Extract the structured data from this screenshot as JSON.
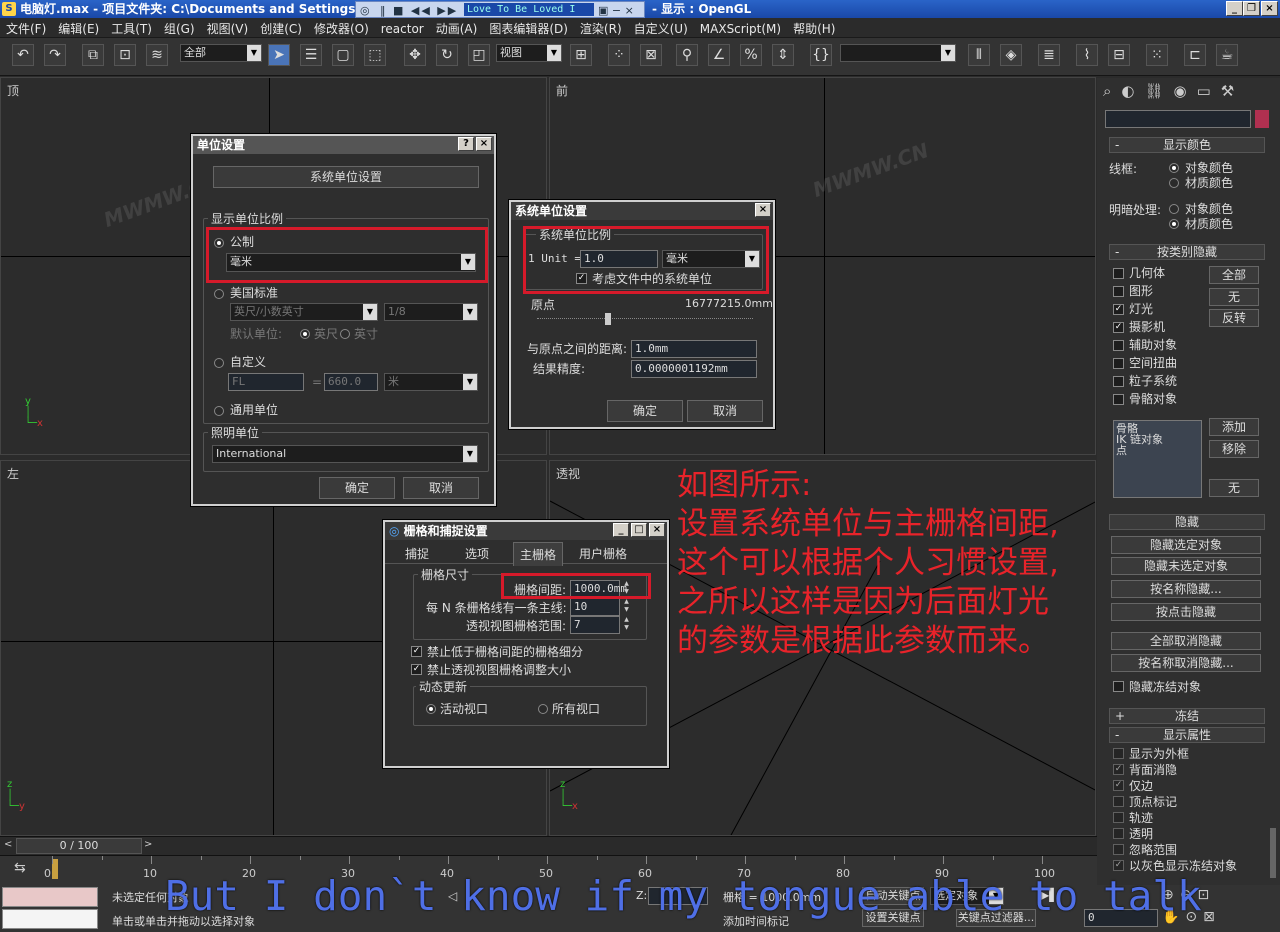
{
  "window": {
    "title": "电脑灯.max   - 项目文件夹: C:\\Documents and Settings\\",
    "suffix": "- 显示 : OpenGL",
    "app_icon": "3ds-max-icon"
  },
  "media": {
    "song": "Love To Be Loved I"
  },
  "menu": [
    "文件(F)",
    "编辑(E)",
    "工具(T)",
    "组(G)",
    "视图(V)",
    "创建(C)",
    "修改器(O)",
    "reactor",
    "动画(A)",
    "图表编辑器(D)",
    "渲染(R)",
    "自定义(U)",
    "MAXScript(M)",
    "帮助(H)"
  ],
  "toolbar": {
    "selection_filter": "全部",
    "ref_coord": "视图"
  },
  "viewports": {
    "top": "顶",
    "front": "前",
    "left": "左",
    "persp": "透视"
  },
  "watermark": "MWMW.CN",
  "units_dialog": {
    "title": "单位设置",
    "help": "?",
    "close": "×",
    "system_btn": "系统单位设置",
    "display_group": "显示单位比例",
    "metric_label": "公制",
    "metric_value": "毫米",
    "us_label": "美国标准",
    "us_value": "英尺/小数英寸",
    "us_frac": "1/8",
    "default_unit": "默认单位:",
    "feet": "英尺",
    "inch": "英寸",
    "custom_label": "自定义",
    "custom_name": "FL",
    "custom_eq": "=",
    "custom_value": "660.0",
    "custom_unit": "米",
    "generic_label": "通用单位",
    "lighting_group": "照明单位",
    "lighting_value": "International",
    "ok": "确定",
    "cancel": "取消"
  },
  "sys_dialog": {
    "title": "系统单位设置",
    "close": "×",
    "group": "系统单位比例",
    "unit_prefix": "1 Unit =",
    "unit_value": "1.0",
    "unit_type": "毫米",
    "respect_label": "考虑文件中的系统单位",
    "origin_label": "原点",
    "origin_value": "16777215.0mm",
    "distance_label": "与原点之间的距离:",
    "distance_value": "1.0mm",
    "precision_label": "结果精度:",
    "precision_value": "0.0000001192mm",
    "ok": "确定",
    "cancel": "取消"
  },
  "grid_dialog": {
    "title": "栅格和捕捉设置",
    "tabs": [
      "捕捉",
      "选项",
      "主栅格",
      "用户栅格"
    ],
    "size_group": "栅格尺寸",
    "spacing_label": "栅格间距:",
    "spacing_value": "1000.0mm",
    "major_label": "每 N 条栅格线有一条主线:",
    "major_value": "10",
    "persp_label": "透视视图栅格范围:",
    "persp_value": "7",
    "inhibit_sub": "禁止低于栅格间距的栅格细分",
    "inhibit_persp": "禁止透视视图栅格调整大小",
    "update_group": "动态更新",
    "active_vp": "活动视口",
    "all_vp": "所有视口"
  },
  "annotation": [
    "如图所示:",
    "设置系统单位与主栅格间距,",
    "这个可以根据个人习惯设置,",
    "之所以这样是因为后面灯光",
    "的参数是根据此参数而来。"
  ],
  "panel": {
    "display_color": "显示颜色",
    "wireframe": "线框:",
    "shaded": "明暗处理:",
    "object_color": "对象颜色",
    "material_color": "材质颜色",
    "hide_by_cat": "按类别隐藏",
    "cats": [
      "几何体",
      "图形",
      "灯光",
      "摄影机",
      "辅助对象",
      "空间扭曲",
      "粒子系统",
      "骨骼对象"
    ],
    "cat_checked": [
      false,
      false,
      true,
      true,
      false,
      false,
      false,
      false
    ],
    "all": "全部",
    "none": "无",
    "invert": "反转",
    "list": [
      "骨骼",
      "IK 链对象",
      "点"
    ],
    "add": "添加",
    "remove": "移除",
    "none2": "无",
    "hide": "隐藏",
    "hide_sel": "隐藏选定对象",
    "hide_unsel": "隐藏未选定对象",
    "hide_name": "按名称隐藏...",
    "hide_click": "按点击隐藏",
    "unhide_all": "全部取消隐藏",
    "unhide_name": "按名称取消隐藏...",
    "hide_frozen": "隐藏冻结对象",
    "freeze": "冻结",
    "disp_props": "显示属性",
    "props": [
      "显示为外框",
      "背面消隐",
      "仅边",
      "顶点标记",
      "轨迹",
      "透明",
      "忽略范围",
      "以灰色显示冻结对象"
    ],
    "props_checked": [
      false,
      true,
      true,
      false,
      false,
      false,
      false,
      true
    ]
  },
  "timeline": {
    "frame": "0 / 100",
    "ticks": [
      "0",
      "10",
      "20",
      "30",
      "40",
      "50",
      "60",
      "70",
      "80",
      "90",
      "100"
    ]
  },
  "status": {
    "selected": "未选定任何对象",
    "prompt": "单击或单击并拖动以选择对象",
    "grid": "栅格 = 1000.0mm",
    "autokey": "自动关键点",
    "setkey": "设置关键点",
    "addtime": "添加时间标记",
    "selected_set": "选定对象",
    "keyfilter": "关键点过滤器...",
    "frame_field": "0"
  },
  "subtitle": "But I don`t know if my tongue able to talk"
}
